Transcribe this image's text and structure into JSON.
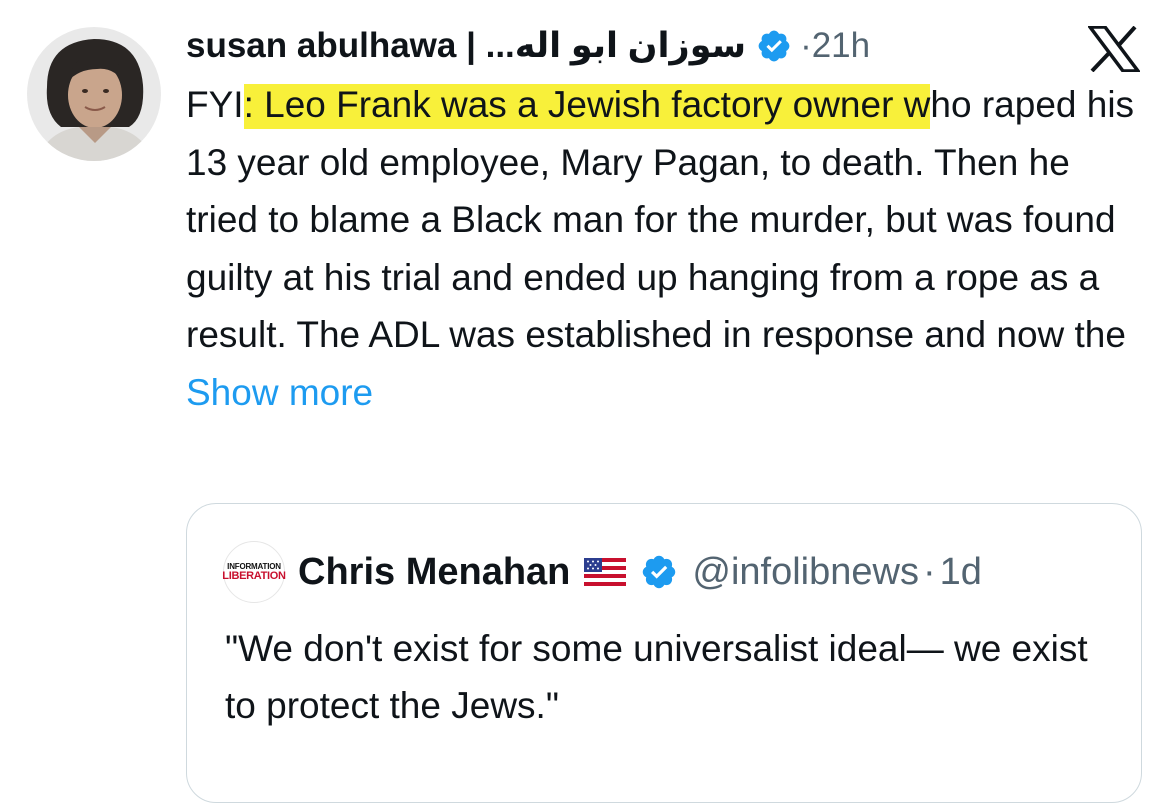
{
  "tweet": {
    "author": {
      "display_name": "susan abulhawa | ...سوزان ابو اله",
      "verified": true,
      "avatar_icon": "profile-photo"
    },
    "dot": "·",
    "time": "21h",
    "platform_icon": "x-logo-icon",
    "text": {
      "pre": "FYI",
      "highlighted": ": Leo Frank was a Jewish factory owner w",
      "post": "ho raped his 13 year old employee, Mary Pagan, to death. Then he tried to blame a Black man for the murder, but was found guilty at his trial and ended up hanging from a rope as a result.  The ADL was established in response and now the ",
      "show_more": "Show more"
    },
    "highlight_color": "#f8f03a"
  },
  "quote": {
    "avatar": {
      "line1": "INFORMATION",
      "line2": "LIBERATION"
    },
    "display_name": "Chris Menahan",
    "flag_icon": "us-flag-icon",
    "verified": true,
    "handle": "@infolibnews",
    "dot": "·",
    "time": "1d",
    "text": "\"We don't exist for some universalist ideal— we exist to protect the Jews.\""
  },
  "colors": {
    "link": "#1d9bf0",
    "verified": "#1d9bf0",
    "muted": "#536471",
    "border": "#cfd9de"
  }
}
